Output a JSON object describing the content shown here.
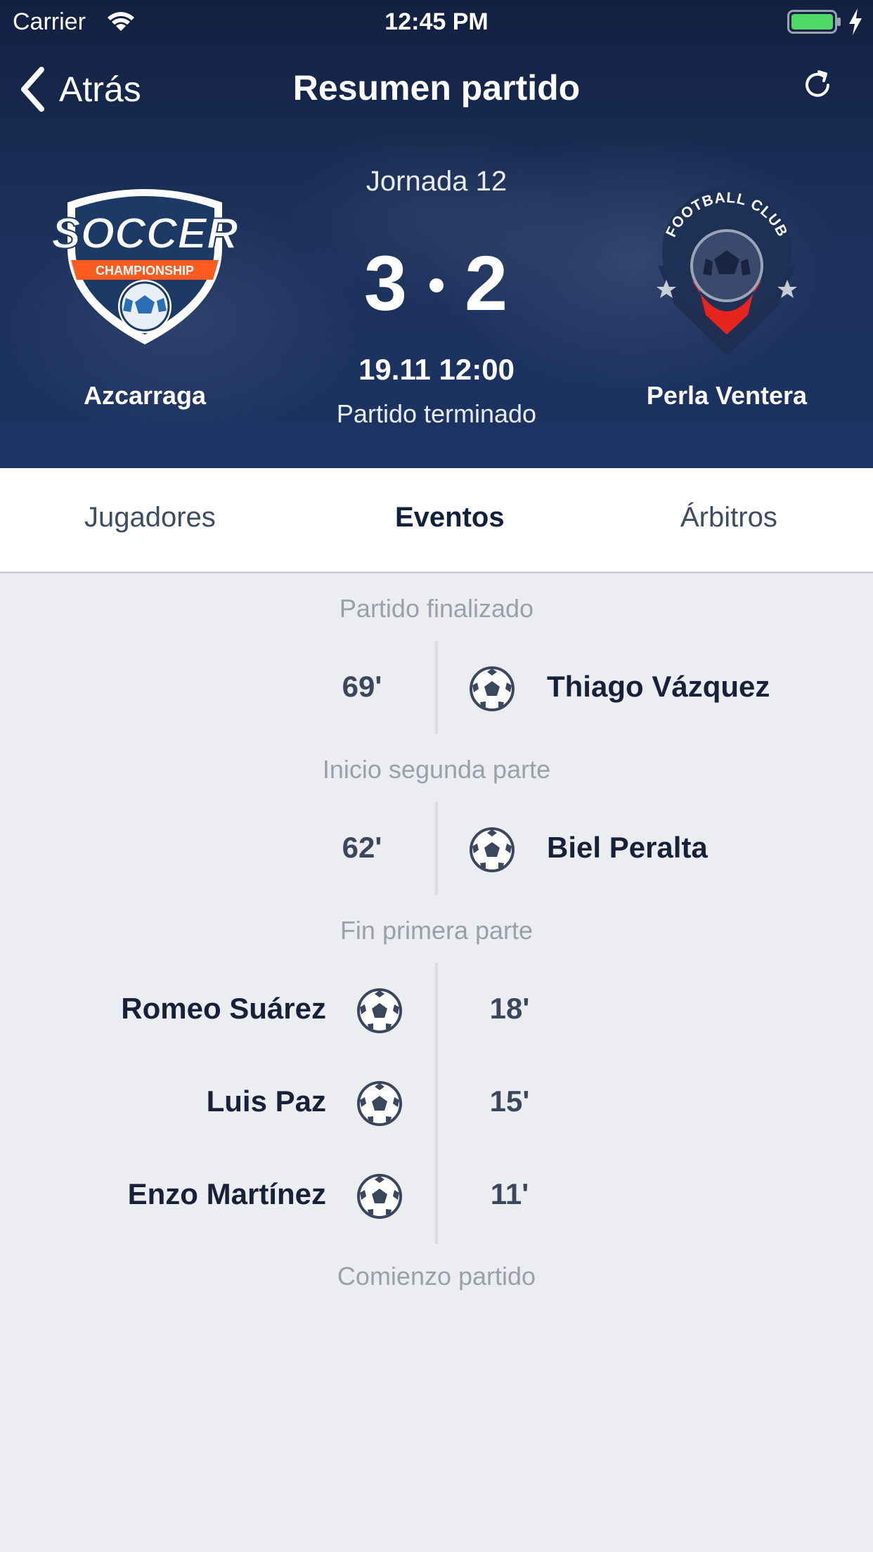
{
  "status_bar": {
    "carrier": "Carrier",
    "time": "12:45 PM"
  },
  "nav": {
    "back_label": "Atrás",
    "title": "Resumen partido"
  },
  "match": {
    "round": "Jornada 12",
    "home_score": "3",
    "away_score": "2",
    "date": "19.11 12:00",
    "status": "Partido terminado",
    "home_team": {
      "name": "Azcarraga",
      "logo_text": "SOCCER",
      "logo_subtext": "CHAMPIONSHIP"
    },
    "away_team": {
      "name": "Perla Ventera",
      "logo_text": "FOOTBALL CLUB"
    }
  },
  "tabs": {
    "players": "Jugadores",
    "events": "Eventos",
    "referees": "Árbitros",
    "active": "events"
  },
  "events": {
    "sections": [
      {
        "label": "Partido finalizado",
        "rows": [
          {
            "side": "away",
            "minute": "69'",
            "player": "Thiago Vázquez",
            "icon": "soccer-ball-icon"
          }
        ]
      },
      {
        "label": "Inicio segunda parte",
        "rows": [
          {
            "side": "away",
            "minute": "62'",
            "player": "Biel Peralta",
            "icon": "soccer-ball-icon"
          }
        ]
      },
      {
        "label": "Fin primera parte",
        "rows": [
          {
            "side": "home",
            "minute": "18'",
            "player": "Romeo Suárez",
            "icon": "soccer-ball-icon"
          },
          {
            "side": "home",
            "minute": "15'",
            "player": "Luis Paz",
            "icon": "soccer-ball-icon"
          },
          {
            "side": "home",
            "minute": "11'",
            "player": "Enzo Martínez",
            "icon": "soccer-ball-icon"
          }
        ]
      }
    ],
    "footer_label": "Comienzo partido"
  },
  "colors": {
    "header_bg": "#1b2f58",
    "tab_active": "#14213d",
    "background": "#ecedf1",
    "battery": "#4cd964",
    "home_accent": "#ff5a1f",
    "away_accent": "#e8241f"
  }
}
